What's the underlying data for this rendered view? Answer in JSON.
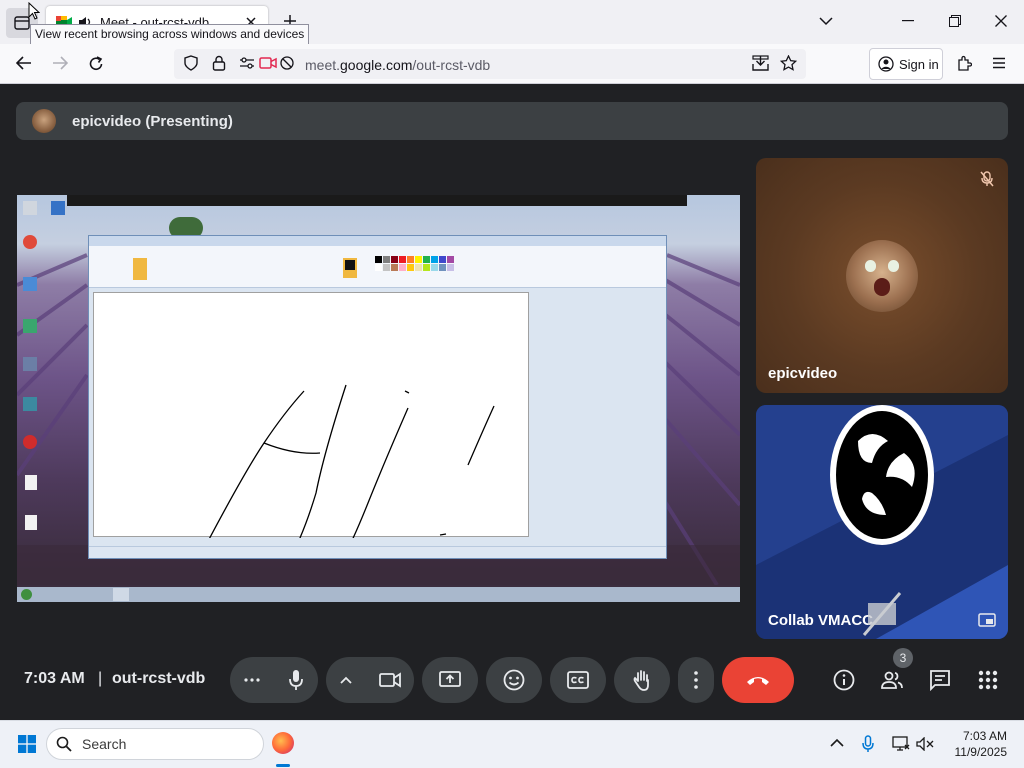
{
  "browser": {
    "tab_title": "Meet - out-rcst-vdb",
    "tooltip": "View recent browsing across windows and devices",
    "url_prefix": "meet.",
    "url_domain": "google.com",
    "url_path": "/out-rcst-vdb",
    "sign_in": "Sign in"
  },
  "meet": {
    "presenter_label": "epicvideo (Presenting)",
    "participants": [
      {
        "name": "epicvideo",
        "muted": true
      },
      {
        "name": "Collab VMACC",
        "camera_off": true
      }
    ],
    "time": "7:03 AM",
    "separator": "|",
    "meeting_code": "out-rcst-vdb",
    "people_count": "3",
    "controls": [
      "more-options",
      "microphone",
      "camera",
      "present",
      "reactions",
      "captions",
      "raise-hand",
      "more-actions",
      "leave-call"
    ],
    "side_controls": [
      "meeting-info",
      "people",
      "chat",
      "activities"
    ]
  },
  "taskbar": {
    "search_placeholder": "Search",
    "time": "7:03 AM",
    "date": "11/9/2025"
  },
  "colors": {
    "meet_bg": "#202124",
    "control_bg": "#3c4043",
    "end_call": "#ea4335",
    "tile_brown": "#5b3a22",
    "tile_blue": "#223a7a"
  }
}
